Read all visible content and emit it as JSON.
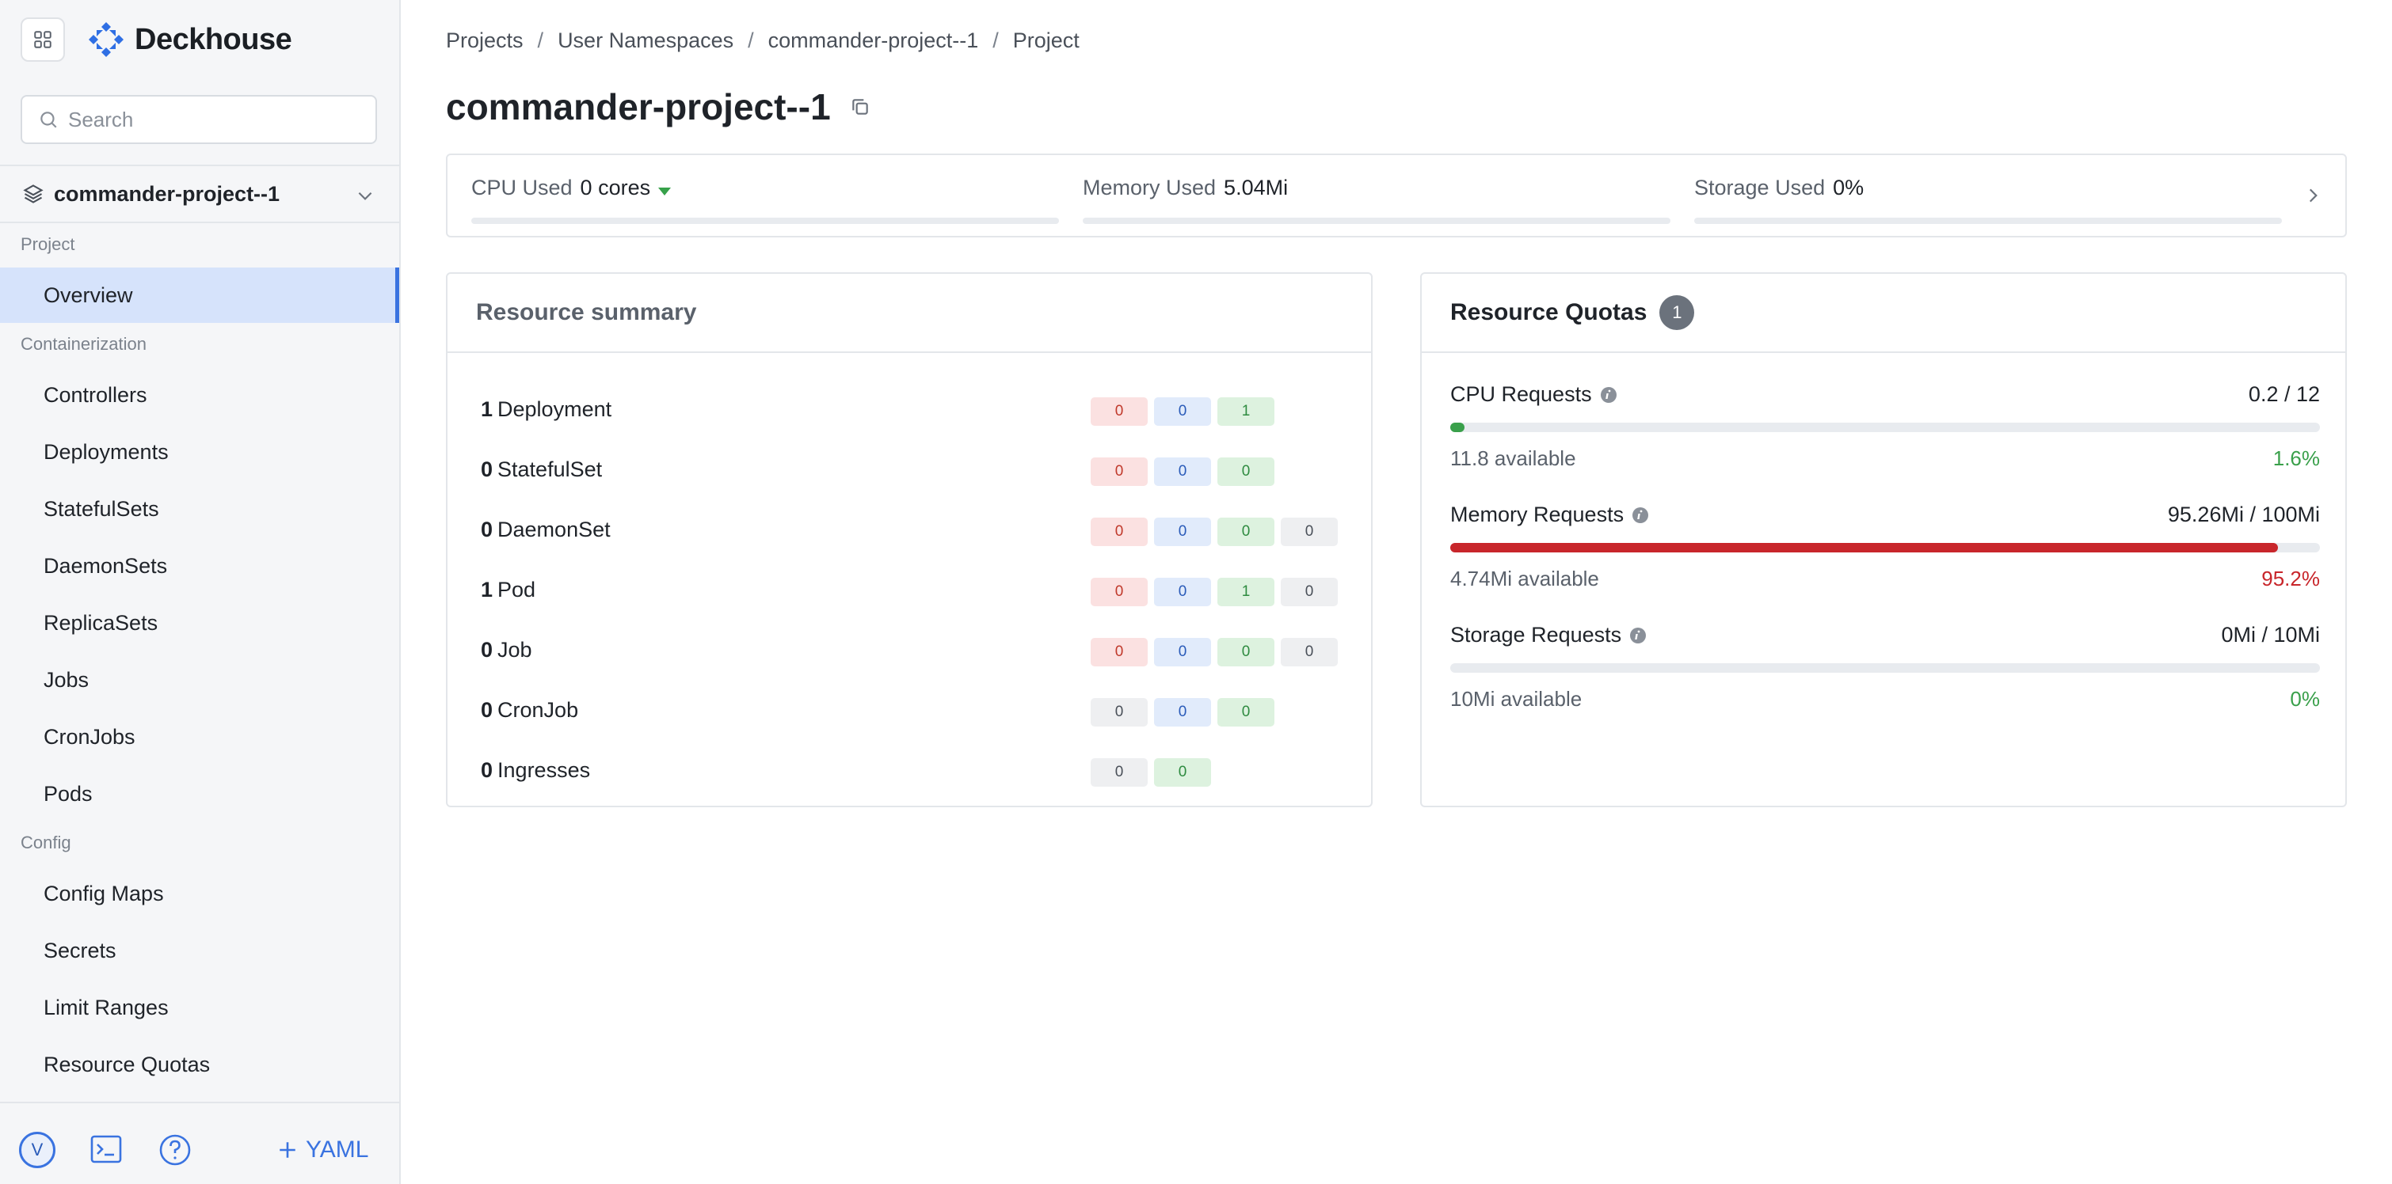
{
  "app": {
    "name": "Deckhouse"
  },
  "sidebar": {
    "search_placeholder": "Search",
    "namespace": "commander-project--1",
    "groups": [
      {
        "label": "Project",
        "items": [
          {
            "label": "Overview",
            "active": true
          }
        ]
      },
      {
        "label": "Containerization",
        "items": [
          {
            "label": "Controllers"
          },
          {
            "label": "Deployments"
          },
          {
            "label": "StatefulSets"
          },
          {
            "label": "DaemonSets"
          },
          {
            "label": "ReplicaSets"
          },
          {
            "label": "Jobs"
          },
          {
            "label": "CronJobs"
          },
          {
            "label": "Pods"
          }
        ]
      },
      {
        "label": "Config",
        "items": [
          {
            "label": "Config Maps"
          },
          {
            "label": "Secrets"
          },
          {
            "label": "Limit Ranges"
          },
          {
            "label": "Resource Quotas"
          }
        ]
      }
    ],
    "footer": {
      "avatar_letter": "V",
      "yaml_label": "YAML"
    }
  },
  "breadcrumb": [
    "Projects",
    "User Namespaces",
    "commander-project--1",
    "Project"
  ],
  "breadcrumb_sep": "/",
  "page_title": "commander-project--1",
  "usage": [
    {
      "label": "CPU Used",
      "value": "0 cores"
    },
    {
      "label": "Memory Used",
      "value": "5.04Mi"
    },
    {
      "label": "Storage Used",
      "value": "0%"
    }
  ],
  "resource_summary": {
    "title": "Resource summary",
    "rows": [
      {
        "count": "1",
        "kind": "Deployment",
        "badges": [
          {
            "v": "0",
            "c": "red"
          },
          {
            "v": "0",
            "c": "blue"
          },
          {
            "v": "1",
            "c": "green"
          }
        ]
      },
      {
        "count": "0",
        "kind": "StatefulSet",
        "badges": [
          {
            "v": "0",
            "c": "red"
          },
          {
            "v": "0",
            "c": "blue"
          },
          {
            "v": "0",
            "c": "green"
          }
        ]
      },
      {
        "count": "0",
        "kind": "DaemonSet",
        "badges": [
          {
            "v": "0",
            "c": "red"
          },
          {
            "v": "0",
            "c": "blue"
          },
          {
            "v": "0",
            "c": "green"
          },
          {
            "v": "0",
            "c": "gray"
          }
        ]
      },
      {
        "count": "1",
        "kind": "Pod",
        "badges": [
          {
            "v": "0",
            "c": "red"
          },
          {
            "v": "0",
            "c": "blue"
          },
          {
            "v": "1",
            "c": "green"
          },
          {
            "v": "0",
            "c": "gray"
          }
        ]
      },
      {
        "count": "0",
        "kind": "Job",
        "badges": [
          {
            "v": "0",
            "c": "red"
          },
          {
            "v": "0",
            "c": "blue"
          },
          {
            "v": "0",
            "c": "green"
          },
          {
            "v": "0",
            "c": "gray"
          }
        ]
      },
      {
        "count": "0",
        "kind": "CronJob",
        "badges": [
          {
            "v": "0",
            "c": "gray"
          },
          {
            "v": "0",
            "c": "blue"
          },
          {
            "v": "0",
            "c": "green"
          }
        ]
      },
      {
        "count": "0",
        "kind": "Ingresses",
        "badges": [
          {
            "v": "0",
            "c": "gray"
          },
          {
            "v": "0",
            "c": "green"
          }
        ]
      }
    ]
  },
  "resource_quotas": {
    "title": "Resource Quotas",
    "count": "1",
    "items": [
      {
        "label": "CPU Requests",
        "value": "0.2 / 12",
        "available": "11.8 available",
        "percent": "1.6%",
        "fill": 0.016,
        "color": "#3aa04b"
      },
      {
        "label": "Memory Requests",
        "value": "95.26Mi / 100Mi",
        "available": "4.74Mi available",
        "percent": "95.2%",
        "fill": 0.952,
        "color": "#c8262b"
      },
      {
        "label": "Storage Requests",
        "value": "0Mi / 10Mi",
        "available": "10Mi available",
        "percent": "0%",
        "fill": 0,
        "color": "#3aa04b"
      }
    ]
  }
}
